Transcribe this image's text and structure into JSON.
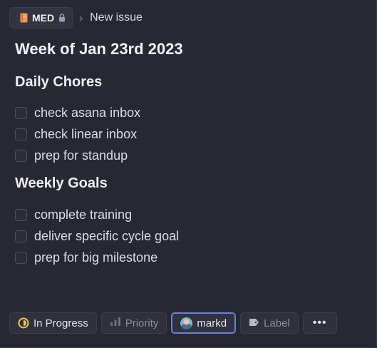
{
  "breadcrumb": {
    "team": "MED",
    "separator": "›",
    "current": "New issue"
  },
  "issue": {
    "title": "Week of Jan 23rd 2023"
  },
  "sections": [
    {
      "heading": "Daily Chores",
      "items": [
        "check asana inbox",
        "check linear inbox",
        "prep for standup"
      ]
    },
    {
      "heading": "Weekly Goals",
      "items": [
        "complete training",
        "deliver specific cycle goal",
        "prep for big milestone"
      ]
    }
  ],
  "toolbar": {
    "status": "In Progress",
    "priority": "Priority",
    "assignee": "markd",
    "label": "Label",
    "more": "•••"
  },
  "colors": {
    "background": "#272832",
    "status_yellow": "#f2c94c",
    "assignee_border": "#6b7fd8",
    "team_icon": "#f2994a"
  },
  "icons": [
    "book-icon",
    "lock-icon",
    "in-progress-icon",
    "priority-bars-icon",
    "avatar",
    "label-tag-icon",
    "more-icon"
  ]
}
